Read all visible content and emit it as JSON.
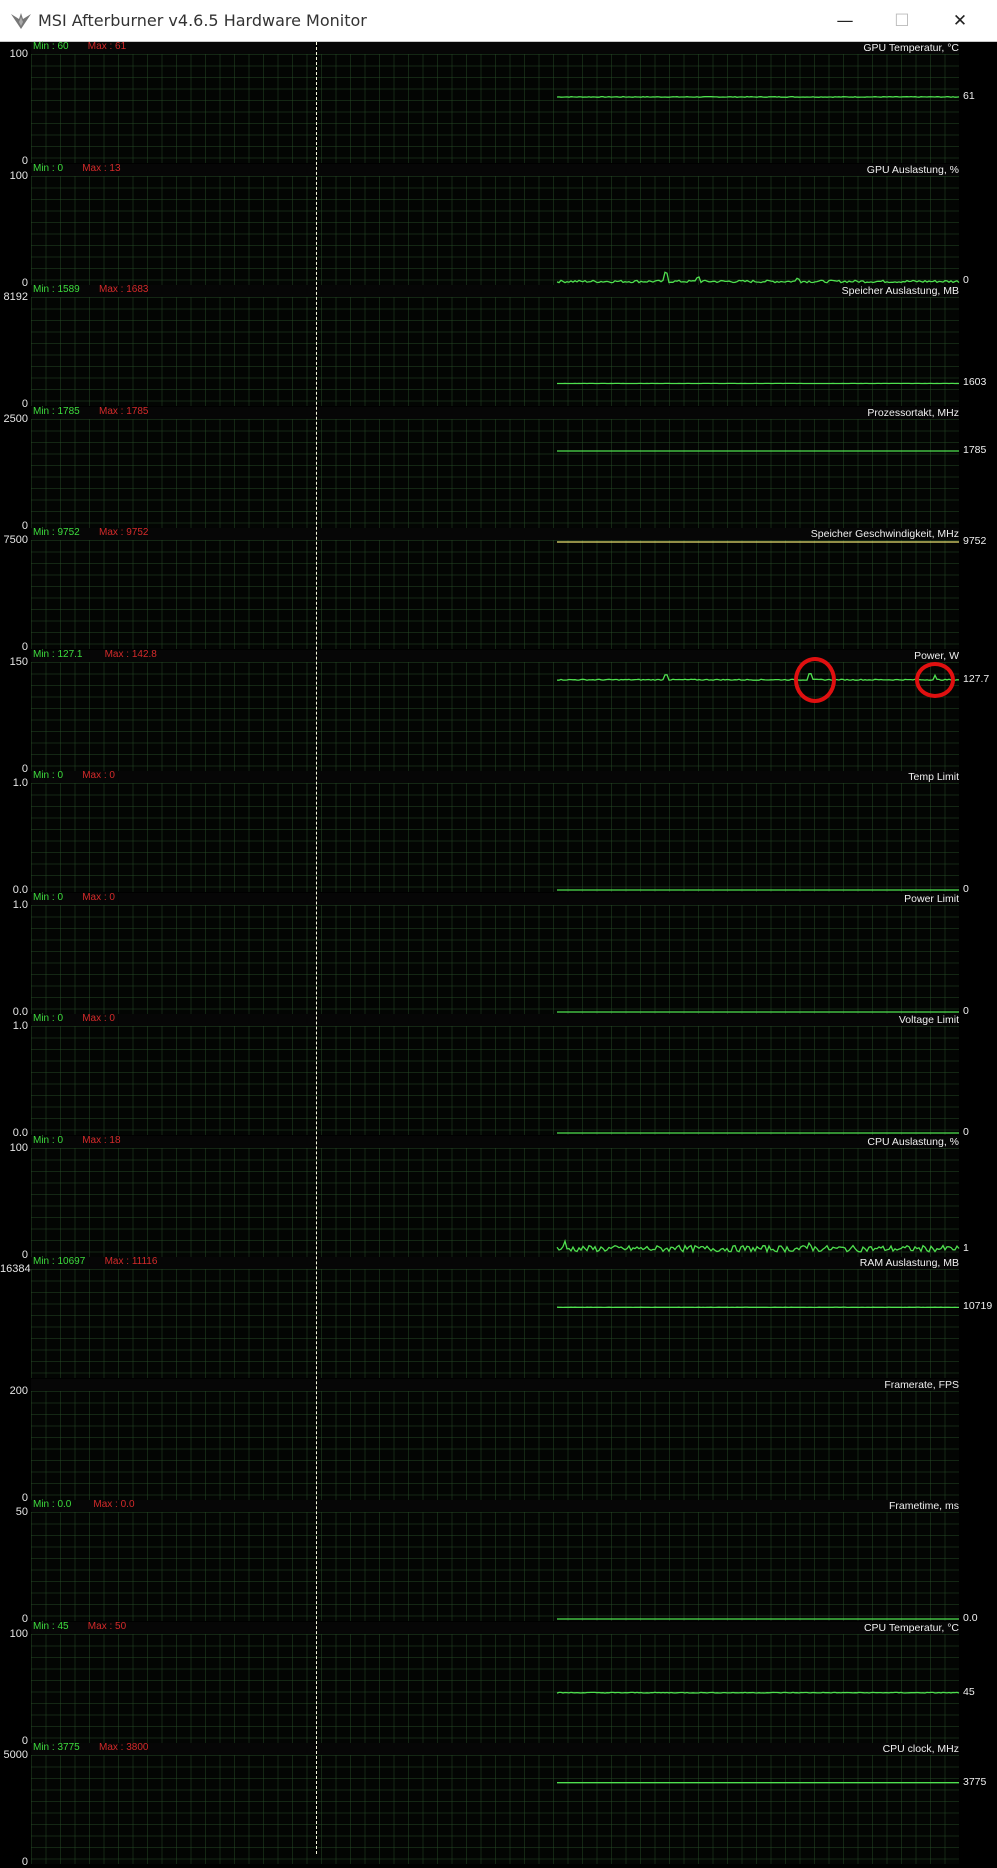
{
  "window": {
    "title": "MSI Afterburner v4.6.5 Hardware Monitor",
    "icon": "afterburner-icon",
    "controls": {
      "minimize": "—",
      "maximize": "☐",
      "close": "✕"
    }
  },
  "colors": {
    "trace": "#4fe04f",
    "trace_yellow": "#e8e070",
    "min_label": "#3ddc3d",
    "max_label": "#d42a2a",
    "annotation": "#e01010"
  },
  "panels": [
    {
      "name": "GPU Temperatur, °C",
      "min_label": "Min : 60",
      "max_label": "Max : 61",
      "y_max": "100",
      "y_min": "0",
      "current": "61",
      "ymax_val": 100,
      "cur": 61,
      "noise": 0.3,
      "spikes": []
    },
    {
      "name": "GPU Auslastung, %",
      "min_label": "Min : 0",
      "max_label": "Max : 13",
      "y_max": "100",
      "y_min": "0",
      "current": "0",
      "ymax_val": 100,
      "cur": 1.5,
      "noise": 1.2,
      "spikes": [
        [
          0.27,
          8
        ],
        [
          0.35,
          4
        ],
        [
          0.6,
          3
        ]
      ]
    },
    {
      "name": "Speicher Auslastung, MB",
      "min_label": "Min : 1589",
      "max_label": "Max : 1683",
      "y_max": "8192",
      "y_min": "0",
      "current": "1603",
      "ymax_val": 8192,
      "cur": 1603,
      "noise": 5,
      "spikes": []
    },
    {
      "name": "Prozessortakt, MHz",
      "min_label": "Min : 1785",
      "max_label": "Max : 1785",
      "y_max": "2500",
      "y_min": "0",
      "current": "1785",
      "ymax_val": 2500,
      "cur": 1785,
      "noise": 0,
      "spikes": []
    },
    {
      "name": "Speicher Geschwindigkeit, MHz",
      "min_label": "Min : 9752",
      "max_label": "Max : 9752",
      "y_max": "7500",
      "y_min": "0",
      "current": "9752",
      "ymax_val": 7500,
      "cur": 7500,
      "noise": 0,
      "spikes": [],
      "yellow": true
    },
    {
      "name": "Power, W",
      "min_label": "Min : 127.1",
      "max_label": "Max : 142.8",
      "y_max": "150",
      "y_min": "0",
      "current": "127.7",
      "ymax_val": 150,
      "cur": 127.5,
      "noise": 0.7,
      "spikes": [
        [
          0.27,
          5
        ],
        [
          0.63,
          6
        ],
        [
          0.94,
          4
        ]
      ],
      "annotations": 2
    },
    {
      "name": "Temp Limit",
      "min_label": "Min : 0",
      "max_label": "Max : 0",
      "y_max": "1.0",
      "y_min": "0.0",
      "current": "0",
      "ymax_val": 1,
      "cur": 0,
      "noise": 0,
      "spikes": []
    },
    {
      "name": "Power Limit",
      "min_label": "Min : 0",
      "max_label": "Max : 0",
      "y_max": "1.0",
      "y_min": "0.0",
      "current": "0",
      "ymax_val": 1,
      "cur": 0,
      "noise": 0,
      "spikes": []
    },
    {
      "name": "Voltage Limit",
      "min_label": "Min : 0",
      "max_label": "Max : 0",
      "y_max": "1.0",
      "y_min": "0.0",
      "current": "0",
      "ymax_val": 1,
      "cur": 0,
      "noise": 0,
      "spikes": []
    },
    {
      "name": "CPU Auslastung, %",
      "min_label": "Min : 0",
      "max_label": "Max : 18",
      "y_max": "100",
      "y_min": "0",
      "current": "1",
      "ymax_val": 100,
      "cur": 6,
      "noise": 3,
      "spikes": [
        [
          0.02,
          6
        ],
        [
          0.3,
          4
        ],
        [
          0.63,
          5
        ]
      ]
    },
    {
      "name": "RAM Auslastung, MB",
      "min_label": "Min : 10697",
      "max_label": "Max : 11116",
      "y_max": "16384",
      "y_min": "",
      "current": "10719",
      "ymax_val": 16384,
      "cur": 10719,
      "noise": 12,
      "spikes": []
    },
    {
      "name": "Framerate, FPS",
      "min_label": "",
      "max_label": "",
      "y_max": "200",
      "y_min": "0",
      "current": "",
      "ymax_val": 200,
      "cur": null,
      "noise": 0,
      "spikes": []
    },
    {
      "name": "Frametime, ms",
      "min_label": "Min : 0.0",
      "max_label": "Max : 0.0",
      "y_max": "50",
      "y_min": "0",
      "current": "0.0",
      "ymax_val": 50,
      "cur": 0,
      "noise": 0,
      "spikes": []
    },
    {
      "name": "CPU Temperatur, °C",
      "min_label": "Min : 45",
      "max_label": "Max : 50",
      "y_max": "100",
      "y_min": "0",
      "current": "45",
      "ymax_val": 100,
      "cur": 46,
      "noise": 0.35,
      "spikes": []
    },
    {
      "name": "CPU clock, MHz",
      "min_label": "Min : 3775",
      "max_label": "Max : 3800",
      "y_max": "5000",
      "y_min": "0",
      "current": "3775",
      "ymax_val": 5000,
      "cur": 3775,
      "noise": 0,
      "spikes": []
    }
  ]
}
